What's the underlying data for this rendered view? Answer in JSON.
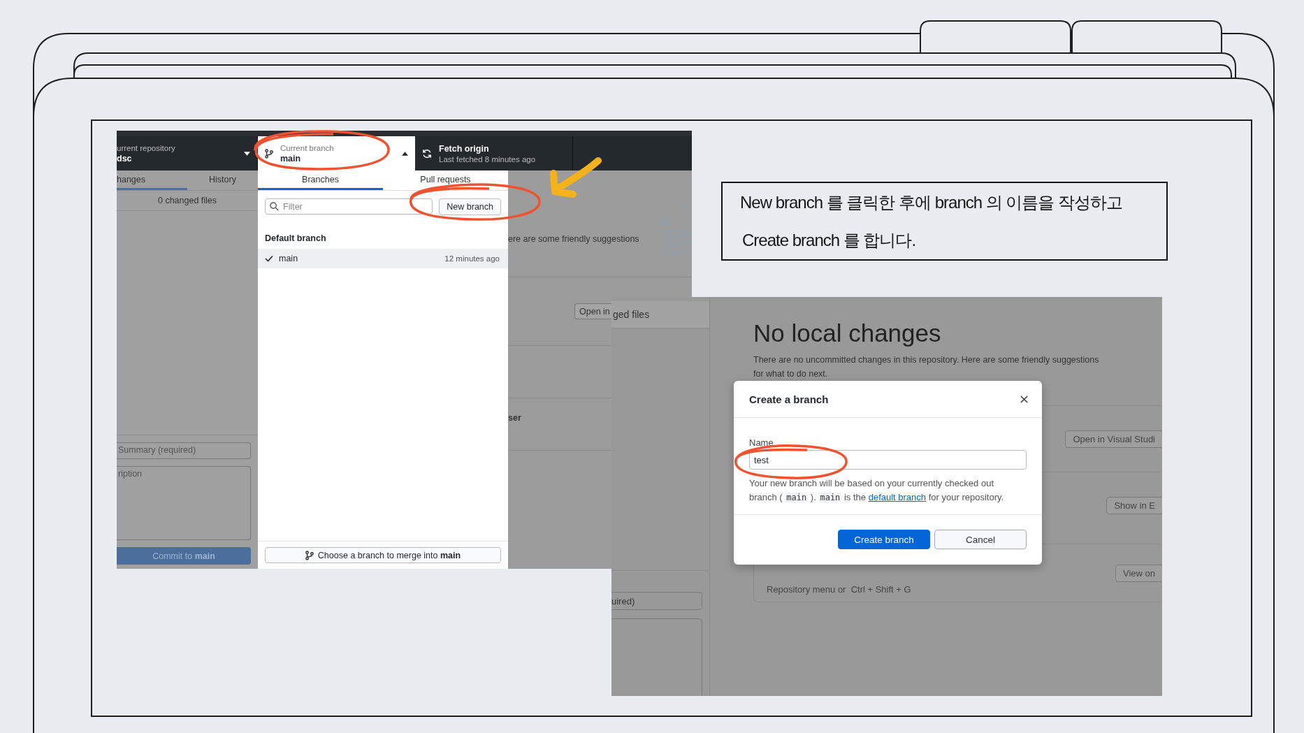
{
  "caption": {
    "lines": [
      "New branch 를 클릭한 후에  branch 의 이름을 작성하고",
      "Create branch 를 합니다."
    ]
  },
  "screen_1": {
    "toolbar": {
      "repository": {
        "label": "urrent repository",
        "value": "dsc"
      },
      "branch": {
        "label": "Current branch",
        "value": "main",
        "expanded": true
      },
      "fetch": {
        "title": "Fetch origin",
        "subtitle": "Last fetched 8 minutes ago"
      }
    },
    "sidebar": {
      "tabs": [
        {
          "label": "hanges",
          "selected": true
        },
        {
          "label": "History",
          "selected": false
        }
      ],
      "changed_files": "0 changed files",
      "summary": {
        "placeholder": "Summary (required)"
      },
      "description": {
        "placeholder": "ription"
      },
      "commit_button": "Commit to **main**"
    },
    "branch_menu": {
      "tabs": [
        {
          "label": "Branches",
          "selected": true
        },
        {
          "label": "Pull requests",
          "selected": false
        }
      ],
      "filter": {
        "placeholder": "Filter"
      },
      "new_branch_button": "New branch",
      "sections": [
        {
          "title": "Default branch",
          "branches": [
            {
              "name": "main",
              "time": "12 minutes ago",
              "selected": true
            }
          ]
        }
      ],
      "merge_button": "Choose a branch to merge into **main**"
    },
    "background": {
      "suggestion_text": "ere are some friendly suggestions",
      "open_button": "Open in",
      "item_title": "ser"
    }
  },
  "screen_2": {
    "sidebar": {
      "changed_files": "ged files",
      "summary": {
        "placeholder": "uired)"
      }
    },
    "heading": "No local changes",
    "description": "There are no uncommitted changes in this repository. Here are some friendly suggestions for what to do next.",
    "actions": [
      {
        "button": "Open in Visual Studi"
      },
      {
        "button": "Show in E"
      },
      {
        "button": "View on",
        "hint": "Repository menu or  Ctrl + Shift + G"
      }
    ]
  },
  "dialog": {
    "title": "Create a branch",
    "name_field": {
      "label": "Name",
      "value": "test"
    },
    "help": [
      {
        "kind": "text",
        "text": "Your new branch will be based on your currently checked out branch ("
      },
      {
        "kind": "code",
        "text": "main"
      },
      {
        "kind": "text",
        "text": ")."
      },
      {
        "kind": "code",
        "text": "main"
      },
      {
        "kind": "text",
        "text": "is the"
      },
      {
        "kind": "link",
        "text": "default branch"
      },
      {
        "kind": "text",
        "text": "for your repository."
      }
    ],
    "buttons": [
      {
        "label": "Create branch",
        "kind": "primary"
      },
      {
        "label": "Cancel",
        "kind": "secondary"
      }
    ]
  }
}
